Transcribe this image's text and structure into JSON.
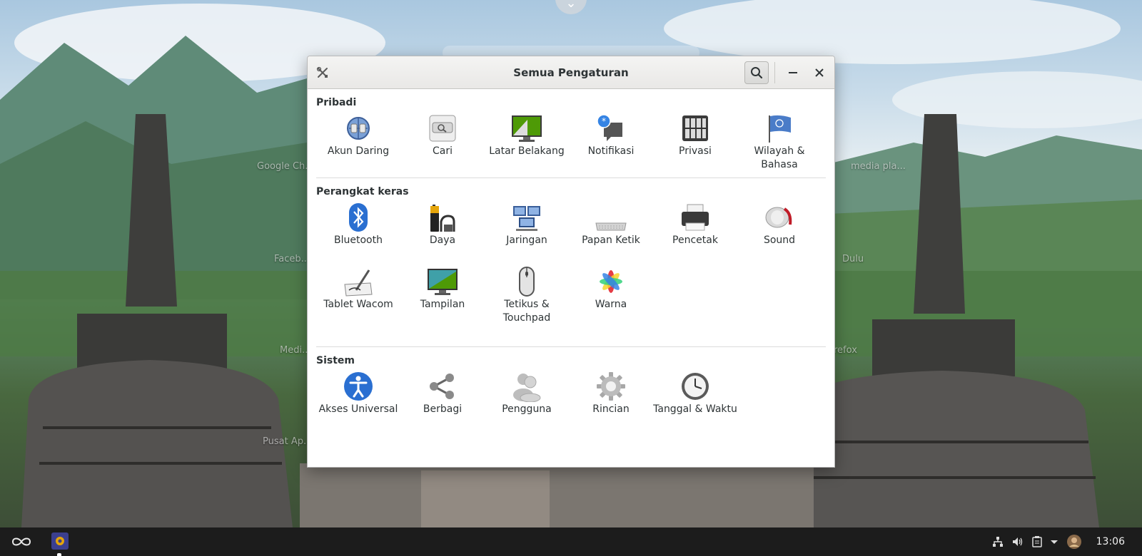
{
  "window": {
    "title": "Semua Pengaturan",
    "app_icon": "settings-tools-icon",
    "buttons": {
      "search": "search-icon",
      "minimize": "minimize-icon",
      "close": "close-icon"
    }
  },
  "sections": {
    "personal": {
      "title": "Pribadi",
      "items": [
        {
          "label": "Akun Daring",
          "icon": "online-accounts-icon"
        },
        {
          "label": "Cari",
          "icon": "search-settings-icon"
        },
        {
          "label": "Latar Belakang",
          "icon": "background-icon"
        },
        {
          "label": "Notifikasi",
          "icon": "notifications-icon"
        },
        {
          "label": "Privasi",
          "icon": "privacy-icon"
        },
        {
          "label": "Wilayah & Bahasa",
          "icon": "region-language-icon"
        }
      ]
    },
    "hardware": {
      "title": "Perangkat keras",
      "items": [
        {
          "label": "Bluetooth",
          "icon": "bluetooth-icon"
        },
        {
          "label": "Daya",
          "icon": "power-icon"
        },
        {
          "label": "Jaringan",
          "icon": "network-icon"
        },
        {
          "label": "Papan Ketik",
          "icon": "keyboard-icon"
        },
        {
          "label": "Pencetak",
          "icon": "printer-icon"
        },
        {
          "label": "Sound",
          "icon": "sound-icon"
        },
        {
          "label": "Tablet Wacom",
          "icon": "wacom-tablet-icon"
        },
        {
          "label": "Tampilan",
          "icon": "display-icon"
        },
        {
          "label": "Tetikus & Touchpad",
          "icon": "mouse-icon"
        },
        {
          "label": "Warna",
          "icon": "color-icon"
        }
      ]
    },
    "system": {
      "title": "Sistem",
      "items": [
        {
          "label": "Akses Universal",
          "icon": "universal-access-icon"
        },
        {
          "label": "Berbagi",
          "icon": "sharing-icon"
        },
        {
          "label": "Pengguna",
          "icon": "users-icon"
        },
        {
          "label": "Rincian",
          "icon": "details-gear-icon"
        },
        {
          "label": "Tanggal & Waktu",
          "icon": "date-time-icon"
        }
      ]
    }
  },
  "desktop_icons": [
    {
      "label": "Google Ch...",
      "icon": "chrome-icon"
    },
    {
      "label": "media pla...",
      "icon": "vlc-icon"
    },
    {
      "label": "Faceb...",
      "icon": "facebook-icon"
    },
    {
      "label": "Dulu",
      "icon": "app-icon"
    },
    {
      "label": "Medi...",
      "icon": "media-icon"
    },
    {
      "label": "refox",
      "icon": "firefox-icon"
    },
    {
      "label": "Pusat Ap...",
      "icon": "app-center-icon"
    }
  ],
  "taskbar": {
    "clock": "13:06",
    "tray_icons": [
      "network-tray-icon",
      "volume-icon",
      "clipboard-icon",
      "menu-arrow-icon",
      "user-avatar"
    ]
  },
  "colors": {
    "window_bg": "#ffffff",
    "titlebar": "#ecebe9",
    "taskbar": "#1c1c1c",
    "text": "#2e3436"
  }
}
